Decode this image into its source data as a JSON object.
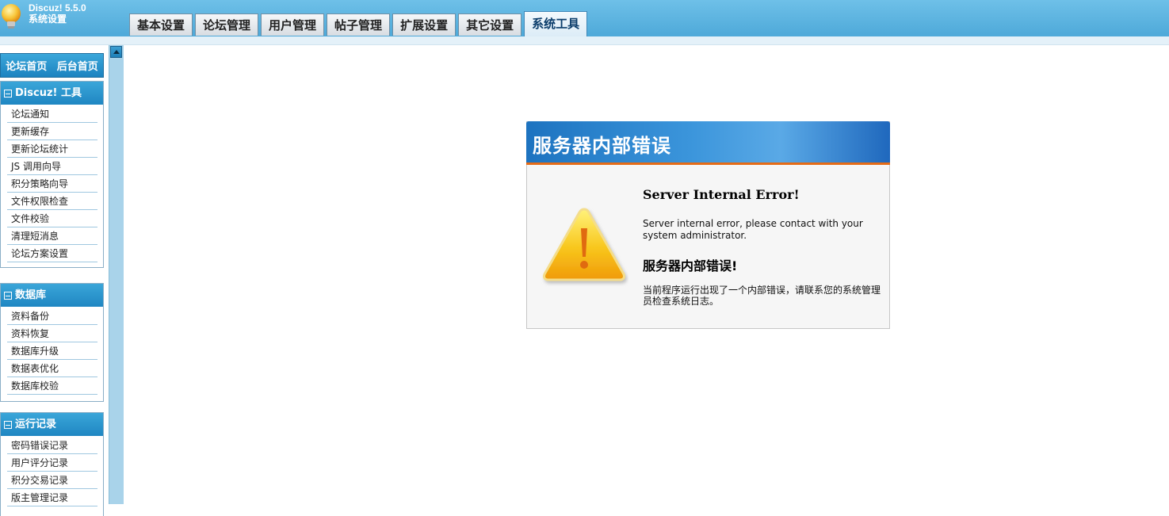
{
  "brand": {
    "version": "Discuz! 5.5.0",
    "subtitle": "系统设置"
  },
  "tabs": [
    "基本设置",
    "论坛管理",
    "用户管理",
    "帖子管理",
    "扩展设置",
    "其它设置",
    "系统工具"
  ],
  "active_tab": "系统工具",
  "sidebar": {
    "quick_links": [
      "论坛首页",
      "后台首页"
    ],
    "panels": [
      {
        "title": "Discuz! 工具",
        "items": [
          "论坛通知",
          "更新缓存",
          "更新论坛统计",
          "JS 调用向导",
          "积分策略向导",
          "文件权限检查",
          "文件校验",
          "清理短消息",
          "论坛方案设置"
        ]
      },
      {
        "title": "数据库",
        "items": [
          "资料备份",
          "资料恢复",
          "数据库升级",
          "数据表优化",
          "数据库校验"
        ]
      },
      {
        "title": "运行记录",
        "items": [
          "密码错误记录",
          "用户评分记录",
          "积分交易记录",
          "版主管理记录"
        ]
      }
    ]
  },
  "error": {
    "header": "服务器内部错误",
    "title_en": "Server Internal Error!",
    "message_en": "Server internal error, please contact with your system administrator.",
    "title_cn": "服务器内部错误!",
    "message_cn": "当前程序运行出现了一个内部错误，请联系您的系统管理员检查系统日志。"
  },
  "colors": {
    "header": "#4ea9d9",
    "panel_head": "#1f86c2",
    "error_accent": "#e56b16",
    "warning": "#f6b40a"
  }
}
